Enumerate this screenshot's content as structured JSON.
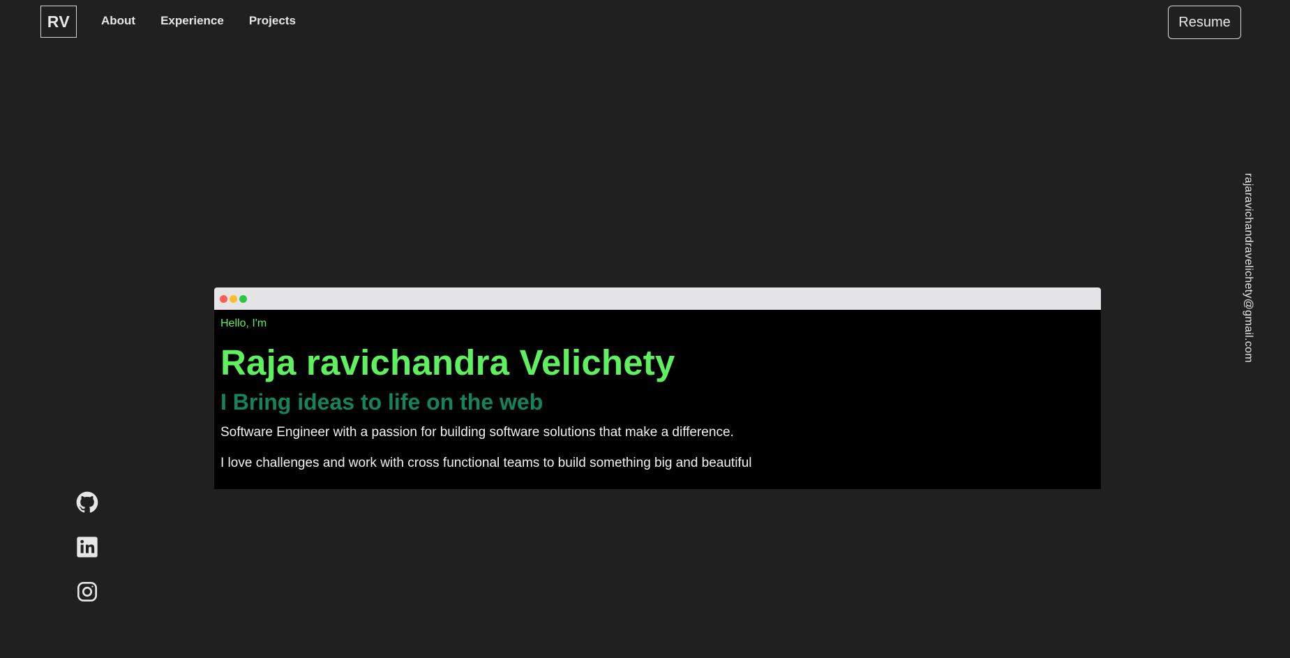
{
  "header": {
    "logo": "RV",
    "nav": [
      {
        "label": "About"
      },
      {
        "label": "Experience"
      },
      {
        "label": "Projects"
      }
    ],
    "resume_label": "Resume"
  },
  "sidebar_right": {
    "email": "rajaravichandravelichety@gmail.com"
  },
  "social": [
    {
      "icon": "github-icon"
    },
    {
      "icon": "linkedin-icon"
    },
    {
      "icon": "instagram-icon"
    }
  ],
  "hero": {
    "greeting": "Hello, I'm",
    "name": "Raja ravichandra Velichety",
    "tagline": "I Bring ideas to life on the web",
    "bio": [
      "Software Engineer with a passion for building software solutions that make a difference.",
      "I love challenges and work with cross functional teams to build something big and beautiful"
    ]
  },
  "colors": {
    "background": "#202020",
    "accent_green": "#5ef05e",
    "tagline_green": "#14855a",
    "terminal_bg": "#000000",
    "titlebar": "#e5e4e6"
  }
}
